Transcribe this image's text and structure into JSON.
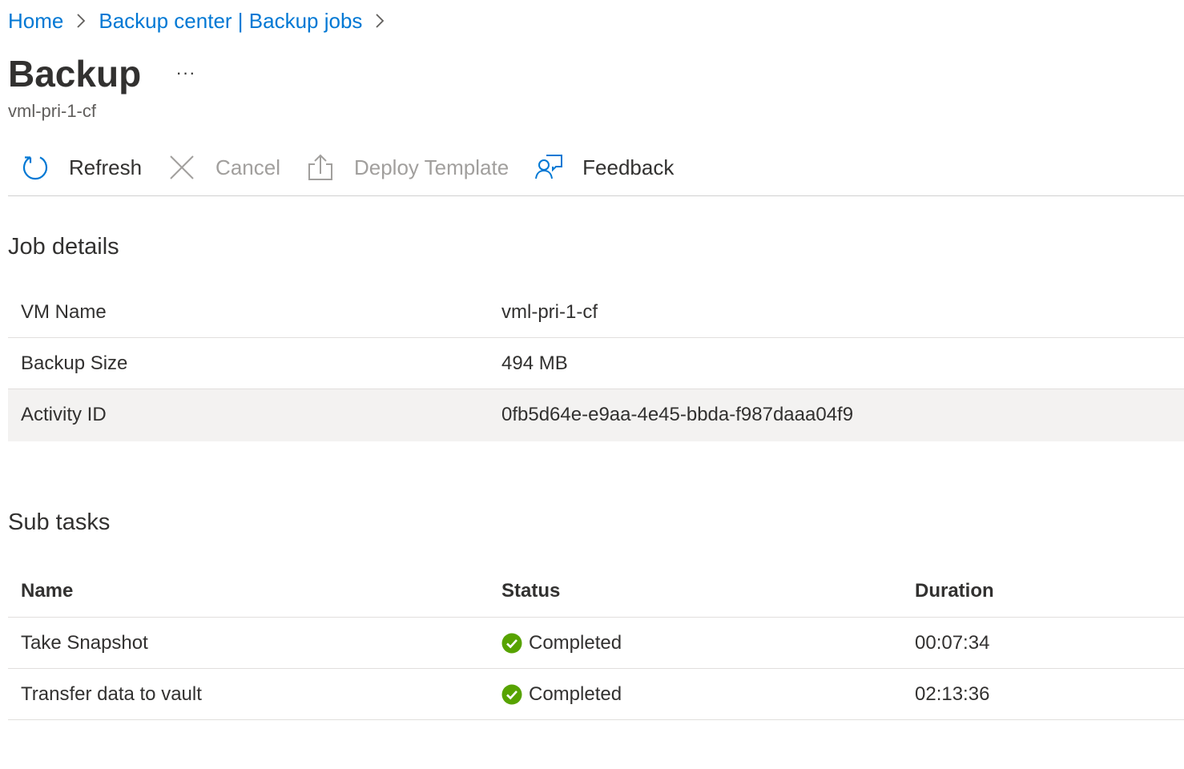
{
  "breadcrumb": {
    "items": [
      {
        "label": "Home"
      },
      {
        "label": "Backup center | Backup jobs"
      }
    ]
  },
  "header": {
    "title": "Backup",
    "more_label": "···",
    "subtitle": "vml-pri-1-cf"
  },
  "toolbar": {
    "refresh_label": "Refresh",
    "cancel_label": "Cancel",
    "deploy_label": "Deploy Template",
    "feedback_label": "Feedback"
  },
  "job_details": {
    "title": "Job details",
    "rows": [
      {
        "label": "VM Name",
        "value": "vml-pri-1-cf"
      },
      {
        "label": "Backup Size",
        "value": "494 MB"
      },
      {
        "label": "Activity ID",
        "value": "0fb5d64e-e9aa-4e45-bbda-f987daaa04f9"
      }
    ]
  },
  "sub_tasks": {
    "title": "Sub tasks",
    "columns": {
      "name": "Name",
      "status": "Status",
      "duration": "Duration"
    },
    "rows": [
      {
        "name": "Take Snapshot",
        "status": "Completed",
        "duration": "00:07:34"
      },
      {
        "name": "Transfer data to vault",
        "status": "Completed",
        "duration": "02:13:36"
      }
    ]
  },
  "colors": {
    "link": "#0078d4",
    "text": "#323130",
    "disabled": "#a19f9d",
    "success": "#57a300",
    "highlight_row": "#f3f2f1"
  },
  "icons": [
    "chevron-right-icon",
    "refresh-icon",
    "cancel-icon",
    "deploy-template-icon",
    "feedback-icon",
    "success-check-icon"
  ]
}
